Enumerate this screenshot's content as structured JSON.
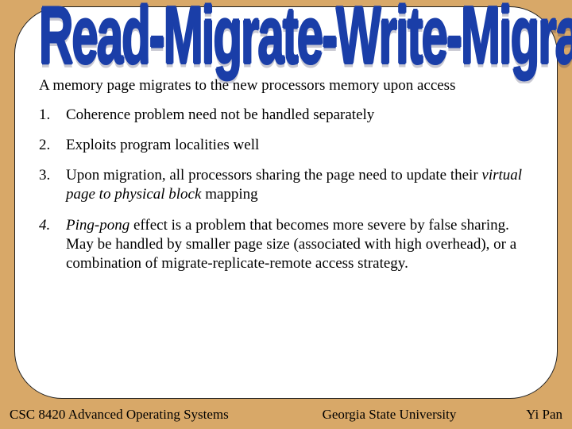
{
  "slide": {
    "title": "Read-Migrate-Write-Migrate",
    "intro": "A memory page migrates to the new processors memory upon access",
    "items": [
      {
        "text_html": "Coherence problem need not be handled separately"
      },
      {
        "text_html": "Exploits program localities well"
      },
      {
        "text_html": "Upon migration, all processors sharing the page need to update their <span class=\"i\">virtual page to physical block</span> mapping"
      },
      {
        "text_html": "<span class=\"i\">Ping-pong</span> effect is a problem that becomes more severe by false sharing. May be handled by smaller page size (associated with high overhead), or a combination of migrate-replicate-remote access strategy.",
        "italic_marker": true
      }
    ]
  },
  "footer": {
    "course": "CSC 8420 Advanced Operating Systems",
    "university": "Georgia State University",
    "author": "Yi Pan"
  }
}
